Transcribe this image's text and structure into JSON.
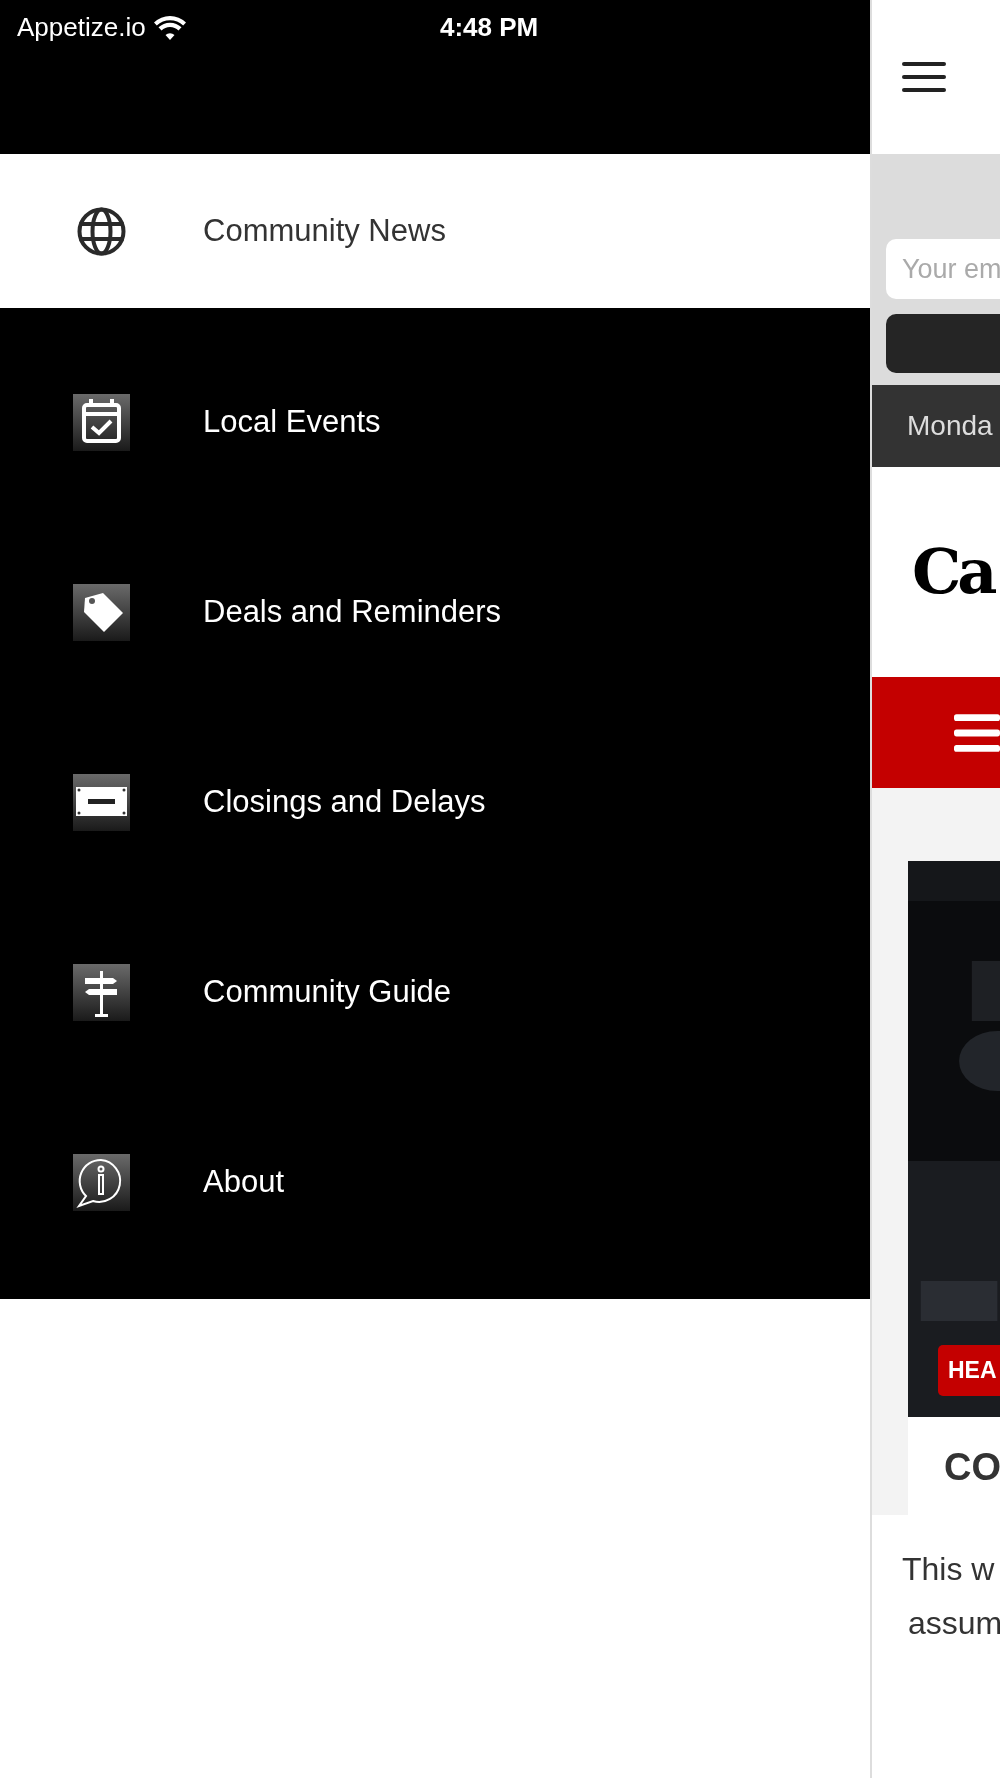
{
  "status_bar": {
    "carrier": "Appetize.io",
    "time": "4:48 PM"
  },
  "drawer": {
    "items": [
      {
        "label": "Community News",
        "kind": "globe",
        "selected": true
      },
      {
        "label": "Local Events",
        "kind": "calendar",
        "selected": false
      },
      {
        "label": "Deals and Reminders",
        "kind": "tag",
        "selected": false
      },
      {
        "label": "Closings and Delays",
        "kind": "sign",
        "selected": false
      },
      {
        "label": "Community Guide",
        "kind": "signpost",
        "selected": false
      },
      {
        "label": "About",
        "kind": "info",
        "selected": false
      }
    ]
  },
  "page_behind": {
    "email_field": {
      "placeholder": "Your em"
    },
    "date": "Monda",
    "logo": "Ca",
    "badge": "HEA",
    "headline": "CO",
    "notice": [
      "This w",
      "assum"
    ]
  }
}
